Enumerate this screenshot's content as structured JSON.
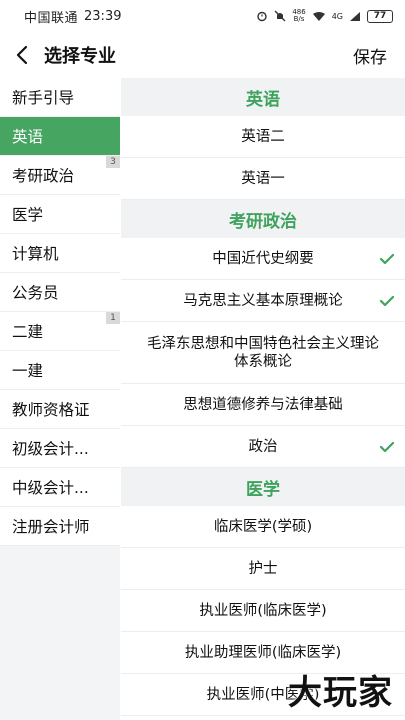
{
  "status_bar": {
    "carrier": "中国联通",
    "time": "23:39",
    "net_speed_top": "486",
    "net_speed_bottom": "B/s",
    "signal": "4G",
    "battery": "77"
  },
  "header": {
    "back_icon": "chevron-left-icon",
    "title": "选择专业",
    "save_label": "保存"
  },
  "sidebar": {
    "items": [
      {
        "label": "新手引导",
        "badge": ""
      },
      {
        "label": "英语",
        "badge": "",
        "active": true
      },
      {
        "label": "考研政治",
        "badge": "3"
      },
      {
        "label": "医学",
        "badge": ""
      },
      {
        "label": "计算机",
        "badge": ""
      },
      {
        "label": "公务员",
        "badge": ""
      },
      {
        "label": "二建",
        "badge": "1"
      },
      {
        "label": "一建",
        "badge": ""
      },
      {
        "label": "教师资格证",
        "badge": ""
      },
      {
        "label": "初级会计...",
        "badge": ""
      },
      {
        "label": "中级会计...",
        "badge": ""
      },
      {
        "label": "注册会计师",
        "badge": ""
      }
    ]
  },
  "groups": [
    {
      "title": "英语",
      "rows": [
        {
          "label": "英语二",
          "checked": false
        },
        {
          "label": "英语一",
          "checked": false
        }
      ]
    },
    {
      "title": "考研政治",
      "rows": [
        {
          "label": "中国近代史纲要",
          "checked": true
        },
        {
          "label": "马克思主义基本原理概论",
          "checked": true
        },
        {
          "label": "毛泽东思想和中国特色社会主义理论体系概论",
          "checked": false
        },
        {
          "label": "思想道德修养与法律基础",
          "checked": false
        },
        {
          "label": "政治",
          "checked": true
        }
      ]
    },
    {
      "title": "医学",
      "rows": [
        {
          "label": "临床医学(学硕)",
          "checked": false
        },
        {
          "label": "护士",
          "checked": false
        },
        {
          "label": "执业医师(临床医学)",
          "checked": false
        },
        {
          "label": "执业助理医师(临床医学)",
          "checked": false
        },
        {
          "label": "执业医师(中医学)",
          "checked": false
        }
      ]
    }
  ],
  "colors": {
    "accent": "#46a561",
    "check": "#3da35d"
  },
  "watermark": "大玩家"
}
